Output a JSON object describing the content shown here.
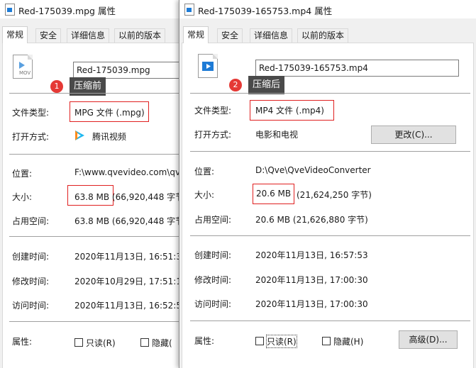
{
  "dialog1": {
    "title": "Red-175039.mpg 属性",
    "tabs": [
      "常规",
      "安全",
      "详细信息",
      "以前的版本"
    ],
    "icon_badge": "MOV",
    "file_name": "Red-175039.mpg",
    "callout": {
      "number": "1",
      "text": "压缩前"
    },
    "file_type": {
      "label": "文件类型:",
      "value": "MPG 文件 (.mpg)"
    },
    "open_with": {
      "label": "打开方式:",
      "app_icon": "tencent-video-icon",
      "value": "腾讯视频"
    },
    "location": {
      "label": "位置:",
      "value": "F:\\www.qvevideo.com\\qv"
    },
    "size": {
      "label": "大小:",
      "value": "63.8 MB (66,920,448 字节"
    },
    "size_on_disk": {
      "label": "占用空间:",
      "value": "63.8 MB (66,920,448 字节"
    },
    "created": {
      "label": "创建时间:",
      "value": "2020年11月13日, 16:51:3"
    },
    "modified": {
      "label": "修改时间:",
      "value": "2020年10月29日, 17:51:1"
    },
    "accessed": {
      "label": "访问时间:",
      "value": "2020年11月13日, 16:52:5"
    },
    "attributes": {
      "label": "属性:",
      "readonly": "只读(R)",
      "hidden": "隐藏("
    }
  },
  "dialog2": {
    "title": "Red-175039-165753.mp4 属性",
    "tabs": [
      "常规",
      "安全",
      "详细信息",
      "以前的版本"
    ],
    "file_name": "Red-175039-165753.mp4",
    "callout": {
      "number": "2",
      "text": "压缩后"
    },
    "file_type": {
      "label": "文件类型:",
      "value": "MP4 文件 (.mp4)"
    },
    "open_with": {
      "label": "打开方式:",
      "value": "电影和电视",
      "change_button": "更改(C)..."
    },
    "location": {
      "label": "位置:",
      "value": "D:\\Qve\\QveVideoConverter"
    },
    "size": {
      "label": "大小:",
      "value": "20.6 MB",
      "bytes": "(21,624,250 字节)"
    },
    "size_on_disk": {
      "label": "占用空间:",
      "value": "20.6 MB (21,626,880 字节)"
    },
    "created": {
      "label": "创建时间:",
      "value": "2020年11月13日, 16:57:53"
    },
    "modified": {
      "label": "修改时间:",
      "value": "2020年11月13日, 17:00:30"
    },
    "accessed": {
      "label": "访问时间:",
      "value": "2020年11月13日, 17:00:30"
    },
    "attributes": {
      "label": "属性:",
      "readonly": "只读(R)",
      "hidden": "隐藏(H)",
      "advanced_button": "高级(D)..."
    }
  },
  "colors": {
    "highlight": "#e02020",
    "callout_bg": "#4a4a4a",
    "badge": "#e53935",
    "accent": "#1e7bd6"
  }
}
